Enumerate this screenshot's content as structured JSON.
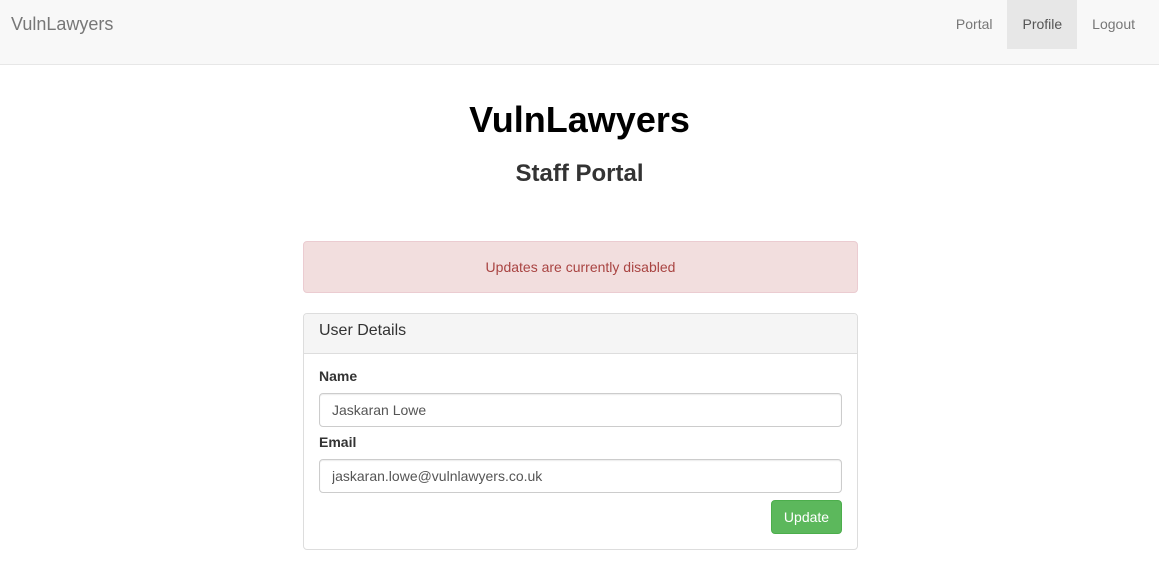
{
  "navbar": {
    "brand": "VulnLawyers",
    "links": [
      {
        "label": "Portal",
        "active": false
      },
      {
        "label": "Profile",
        "active": true
      },
      {
        "label": "Logout",
        "active": false
      }
    ]
  },
  "header": {
    "title": "VulnLawyers",
    "subtitle": "Staff Portal"
  },
  "alert": {
    "message": "Updates are currently disabled",
    "color": "#a94442"
  },
  "panel": {
    "heading": "User Details",
    "fields": [
      {
        "label": "Name",
        "value": "Jaskaran Lowe"
      },
      {
        "label": "Email",
        "value": "jaskaran.lowe@vulnlawyers.co.uk"
      }
    ],
    "button_label": "Update",
    "button_color": "#5cb85c"
  }
}
